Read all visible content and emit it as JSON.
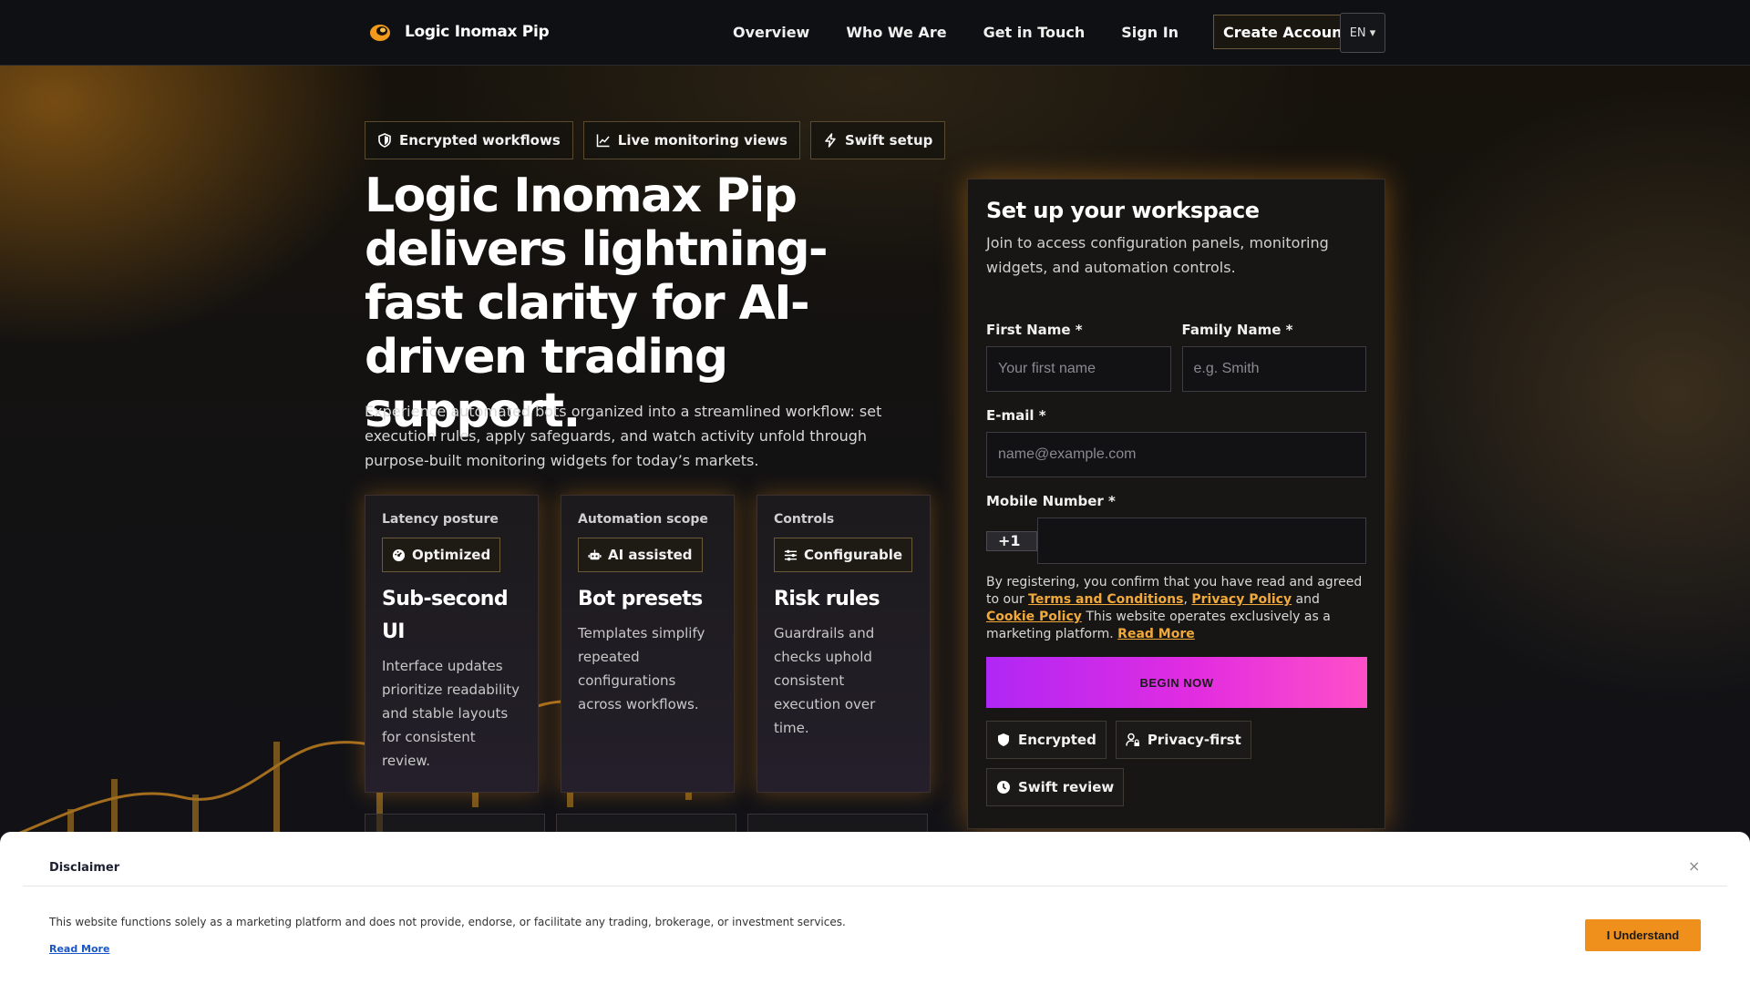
{
  "header": {
    "brand": "Logic Inomax Pip",
    "nav": [
      "Overview",
      "Who We Are",
      "Get in Touch",
      "Sign In"
    ],
    "create_account": "Create Account",
    "language": "EN ▾"
  },
  "badges": [
    "Encrypted workflows",
    "Live monitoring views",
    "Swift setup"
  ],
  "hero": {
    "title": "Logic Inomax Pip delivers lightning-fast clarity for AI-driven trading support.",
    "subtitle": "Experience automated bots organized into a streamlined workflow: set execution rules, apply safeguards, and watch activity unfold through purpose-built monitoring widgets for today’s markets."
  },
  "cards": [
    {
      "eyebrow": "Latency posture",
      "chip": "Optimized",
      "title": "Sub-second UI",
      "text": "Interface updates prioritize readability and stable layouts for consistent review."
    },
    {
      "eyebrow": "Automation scope",
      "chip": "AI assisted",
      "title": "Bot presets",
      "text": "Templates simplify repeated configurations across workflows."
    },
    {
      "eyebrow": "Controls",
      "chip": "Configurable",
      "title": "Risk rules",
      "text": "Guardrails and checks uphold consistent execution over time."
    }
  ],
  "form": {
    "title": "Set up your workspace",
    "subtitle": "Join to access configuration panels, monitoring widgets, and automation controls.",
    "first_name_label": "First Name *",
    "first_name_placeholder": "Your first name",
    "family_name_label": "Family Name *",
    "family_name_placeholder": "e.g. Smith",
    "email_label": "E-mail *",
    "email_placeholder": "name@example.com",
    "mobile_label": "Mobile Number *",
    "mobile_prefix": "+1",
    "legal_prefix": "By registering, you confirm that you have read and agreed to our ",
    "terms": "Terms and Conditions",
    "comma": ", ",
    "privacy": "Privacy Policy",
    "and": " and ",
    "cookie": "Cookie Policy",
    "legal_suffix": " This website operates exclusively as a marketing platform. ",
    "read_more": "Read More",
    "submit": "BEGIN NOW",
    "trust": [
      "Encrypted",
      "Privacy-first",
      "Swift review"
    ]
  },
  "disclaimer": {
    "title": "Disclaimer",
    "close": "×",
    "text": "This website functions solely as a marketing platform and does not provide, endorse, or facilitate any trading, brokerage, or investment services.",
    "read_more": "Read More",
    "button": "I Understand"
  },
  "colors": {
    "accent": "#f0901c",
    "link": "#f0a93a",
    "submit_start": "#b027f5",
    "submit_end": "#ff4fc8"
  }
}
